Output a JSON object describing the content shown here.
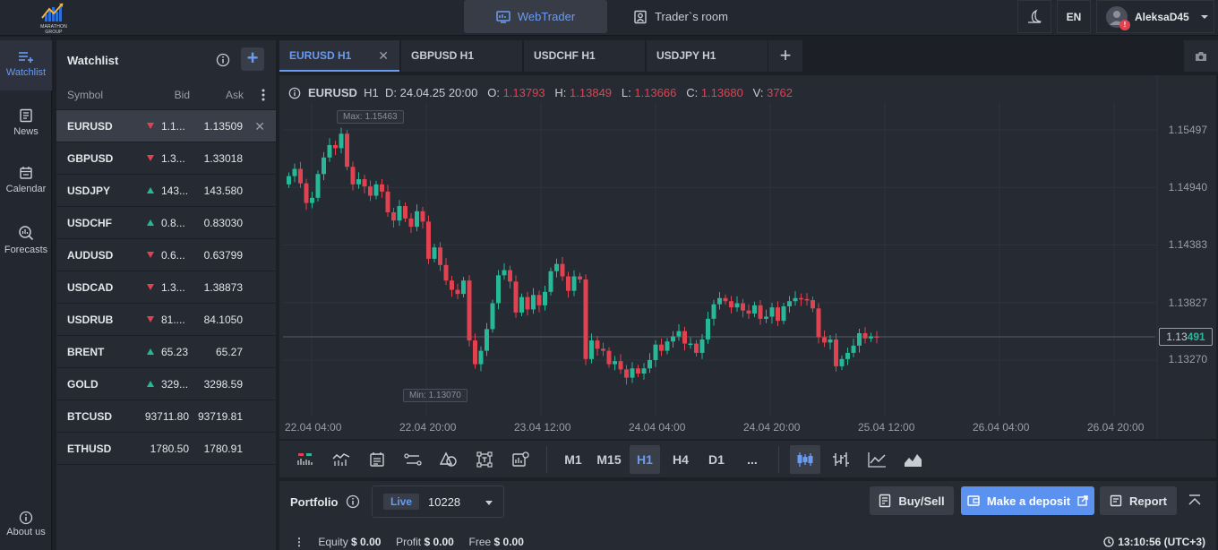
{
  "header": {
    "logo_text": "MARATHON GROUP",
    "webtrader_label": "WebTrader",
    "traders_room_label": "Trader`s room",
    "lang": "EN",
    "username": "AleksaD45",
    "notification_badge": "!"
  },
  "nav": [
    {
      "label": "Watchlist",
      "icon": "watchlist-icon"
    },
    {
      "label": "News",
      "icon": "news-icon"
    },
    {
      "label": "Calendar",
      "icon": "calendar-icon"
    },
    {
      "label": "Forecasts",
      "icon": "forecasts-icon"
    }
  ],
  "about_label": "About us",
  "watchlist": {
    "title": "Watchlist",
    "col_symbol": "Symbol",
    "col_bid": "Bid",
    "col_ask": "Ask",
    "rows": [
      {
        "symbol": "EURUSD",
        "dir": "down",
        "bid": "1.1...",
        "ask": "1.13509"
      },
      {
        "symbol": "GBPUSD",
        "dir": "down",
        "bid": "1.3...",
        "ask": "1.33018"
      },
      {
        "symbol": "USDJPY",
        "dir": "up",
        "bid": "143...",
        "ask": "143.580"
      },
      {
        "symbol": "USDCHF",
        "dir": "up",
        "bid": "0.8...",
        "ask": "0.83030"
      },
      {
        "symbol": "AUDUSD",
        "dir": "down",
        "bid": "0.6...",
        "ask": "0.63799"
      },
      {
        "symbol": "USDCAD",
        "dir": "down",
        "bid": "1.3...",
        "ask": "1.38873"
      },
      {
        "symbol": "USDRUB",
        "dir": "down",
        "bid": "81....",
        "ask": "84.1050"
      },
      {
        "symbol": "BRENT",
        "dir": "up",
        "bid": "65.23",
        "ask": "65.27"
      },
      {
        "symbol": "GOLD",
        "dir": "up",
        "bid": "329...",
        "ask": "3298.59"
      },
      {
        "symbol": "BTCUSD",
        "dir": "",
        "bid": "93711.80",
        "ask": "93719.81"
      },
      {
        "symbol": "ETHUSD",
        "dir": "",
        "bid": "1780.50",
        "ask": "1780.91"
      }
    ]
  },
  "tabs": [
    "EURUSD H1",
    "GBPUSD H1",
    "USDCHF H1",
    "USDJPY H1"
  ],
  "chart_header": {
    "symbol": "EURUSD",
    "timeframe": "H1",
    "date_label": "D: 24.04.25 20:00",
    "o_label": "O:",
    "o": "1.13793",
    "h_label": "H:",
    "h": "1.13849",
    "l_label": "L:",
    "l": "1.13666",
    "c_label": "C:",
    "c": "1.13680",
    "v_label": "V:",
    "v": "3762"
  },
  "chart_data": {
    "type": "candlestick",
    "y_ticks": [
      "1.15497",
      "1.14940",
      "1.14383",
      "1.13827",
      "1.13270"
    ],
    "y_tick_values": [
      1.15497,
      1.1494,
      1.14383,
      1.13827,
      1.1327
    ],
    "x_ticks": [
      "22.04 04:00",
      "22.04 20:00",
      "23.04 12:00",
      "24.04 04:00",
      "24.04 20:00",
      "25.04 12:00",
      "26.04 04:00",
      "26.04 20:00"
    ],
    "max_label": "Max: 1.15463",
    "min_label": "Min: 1.13070",
    "max_value": 1.15463,
    "min_value": 1.1307,
    "current_price_main": "1.13",
    "current_price_hi": "491",
    "current_price_value": 1.13491,
    "bull_color": "#27b897",
    "bear_color": "#e0424f",
    "closes": [
      1.1505,
      1.1512,
      1.1498,
      1.1479,
      1.1484,
      1.1507,
      1.1523,
      1.1535,
      1.1532,
      1.1546,
      1.1514,
      1.1497,
      1.1502,
      1.1495,
      1.1486,
      1.1497,
      1.149,
      1.147,
      1.1462,
      1.1476,
      1.1464,
      1.1456,
      1.1471,
      1.1461,
      1.1425,
      1.1436,
      1.1419,
      1.1404,
      1.1395,
      1.1391,
      1.1404,
      1.1346,
      1.1323,
      1.1336,
      1.1357,
      1.1382,
      1.1409,
      1.1414,
      1.1403,
      1.1373,
      1.1388,
      1.1376,
      1.139,
      1.138,
      1.1393,
      1.1413,
      1.142,
      1.1408,
      1.1394,
      1.1408,
      1.1405,
      1.1328,
      1.1346,
      1.1338,
      1.1336,
      1.1323,
      1.1326,
      1.1318,
      1.131,
      1.1319,
      1.1314,
      1.1319,
      1.1327,
      1.1342,
      1.1336,
      1.1345,
      1.135,
      1.1355,
      1.1343,
      1.1343,
      1.1334,
      1.1347,
      1.1367,
      1.1381,
      1.1387,
      1.1384,
      1.1378,
      1.1382,
      1.1375,
      1.1372,
      1.138,
      1.1367,
      1.1369,
      1.1378,
      1.1365,
      1.1379,
      1.1384,
      1.1387,
      1.1386,
      1.1385,
      1.1377,
      1.1349,
      1.1344,
      1.1347,
      1.1321,
      1.1328,
      1.1334,
      1.1341,
      1.1353,
      1.1348,
      1.135,
      1.1349
    ],
    "opens": [
      1.1497,
      1.1505,
      1.1512,
      1.1498,
      1.1479,
      1.1484,
      1.1507,
      1.1523,
      1.1535,
      1.1532,
      1.1546,
      1.1514,
      1.1497,
      1.1502,
      1.1495,
      1.1486,
      1.1497,
      1.149,
      1.147,
      1.1462,
      1.1476,
      1.1464,
      1.1456,
      1.1471,
      1.1461,
      1.1425,
      1.1436,
      1.1419,
      1.1404,
      1.1395,
      1.1391,
      1.1404,
      1.1346,
      1.1323,
      1.1336,
      1.1357,
      1.1382,
      1.1409,
      1.1414,
      1.1403,
      1.1373,
      1.1388,
      1.1376,
      1.139,
      1.138,
      1.1393,
      1.1413,
      1.142,
      1.1408,
      1.1394,
      1.1408,
      1.1405,
      1.1328,
      1.1346,
      1.1338,
      1.1336,
      1.1323,
      1.1326,
      1.1318,
      1.131,
      1.1319,
      1.1314,
      1.1319,
      1.1327,
      1.1342,
      1.1336,
      1.1345,
      1.135,
      1.1355,
      1.1343,
      1.1343,
      1.1334,
      1.1347,
      1.1367,
      1.1381,
      1.1387,
      1.1384,
      1.1378,
      1.1382,
      1.1375,
      1.1372,
      1.138,
      1.1367,
      1.1369,
      1.1378,
      1.1365,
      1.1379,
      1.1384,
      1.1387,
      1.1386,
      1.1385,
      1.1377,
      1.1349,
      1.1344,
      1.1347,
      1.1321,
      1.1328,
      1.1334,
      1.1341,
      1.1353,
      1.1348,
      1.135
    ]
  },
  "toolbar": {
    "timeframes": [
      "M1",
      "M15",
      "H1",
      "H4",
      "D1",
      "..."
    ],
    "active_timeframe": "H1"
  },
  "portfolio": {
    "title": "Portfolio",
    "account_type": "Live",
    "account_number": "10228",
    "buysell_label": "Buy/Sell",
    "deposit_label": "Make a deposit",
    "report_label": "Report",
    "equity_label": "Equity",
    "equity_value": "$ 0.00",
    "profit_label": "Profit",
    "profit_value": "$ 0.00",
    "free_label": "Free",
    "free_value": "$ 0.00",
    "clock": "13:10:56 (UTC+3)"
  },
  "colors": {
    "accent": "#6a9bf0",
    "deposit_button": "#5b92f0",
    "bull": "#27b897",
    "bear": "#e0424f"
  }
}
